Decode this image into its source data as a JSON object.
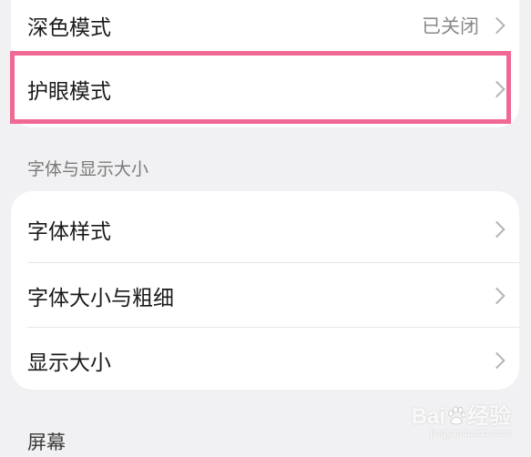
{
  "display_group": {
    "dark_mode": {
      "label": "深色模式",
      "value": "已关闭"
    },
    "eye_comfort": {
      "label": "护眼模式"
    }
  },
  "font_section": {
    "header": "字体与显示大小",
    "items": [
      {
        "label": "字体样式"
      },
      {
        "label": "字体大小与粗细"
      },
      {
        "label": "显示大小"
      }
    ]
  },
  "screen_section": {
    "header": "屏幕"
  },
  "highlight_color": "#f06894",
  "watermark": {
    "text_left": "Bai",
    "text_right": "经验",
    "text_sub": "jingyan.baidu.com"
  }
}
